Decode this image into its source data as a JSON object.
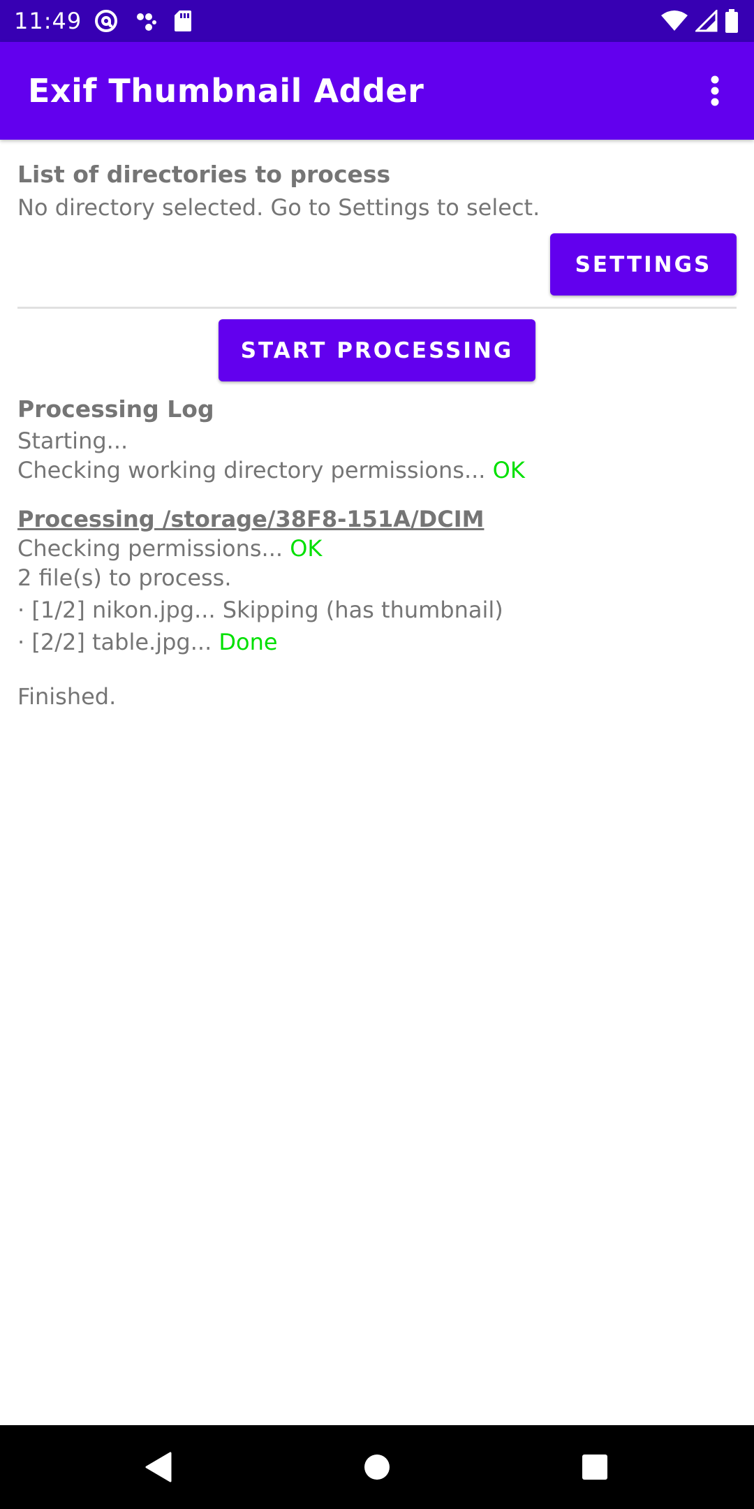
{
  "status_bar": {
    "time": "11:49",
    "left_icons": [
      "at-sign-icon",
      "dots-icon",
      "sd-card-icon"
    ],
    "right_icons": [
      "wifi-icon",
      "signal-icon",
      "battery-icon"
    ]
  },
  "app_bar": {
    "title": "Exif Thumbnail Adder",
    "menu_icon": "more-vert-icon",
    "color": "#6200ee"
  },
  "directories": {
    "heading": "List of directories to process",
    "status": "No directory selected. Go to Settings to select.",
    "settings_label": "SETTINGS"
  },
  "actions": {
    "start_label": "START PROCESSING"
  },
  "log": {
    "heading": "Processing Log",
    "starting": "Starting...",
    "check_workdir": "Checking working directory permissions...",
    "check_workdir_result": "OK",
    "processing_dir": "Processing /storage/38F8-151A/DCIM",
    "check_perms": "Checking permissions...",
    "check_perms_result": "OK",
    "file_count": "2 file(s) to process.",
    "items": [
      {
        "text": "· [1/2] nikon.jpg... Skipping (has thumbnail)",
        "result": ""
      },
      {
        "text": "· [2/2] table.jpg... ",
        "result": "Done"
      }
    ],
    "finished": "Finished.",
    "ok_color": "#00e000"
  },
  "nav_bar": {
    "icons": [
      "back-icon",
      "home-icon",
      "recents-icon"
    ]
  }
}
